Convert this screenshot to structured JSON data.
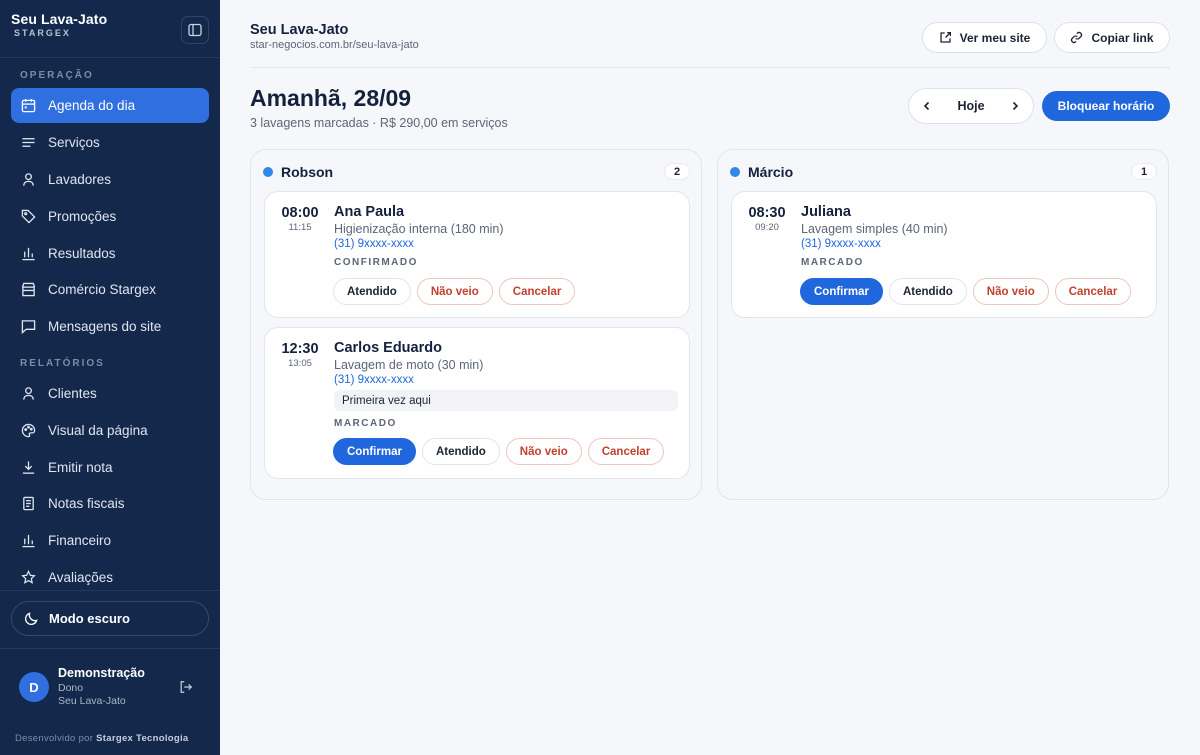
{
  "sidebar": {
    "brand": "Seu Lava-Jato",
    "brand_sub": "STARGEX",
    "section_operacao": "OPERAÇÃO",
    "section_relatorios": "RELATÓRIOS",
    "items": [
      {
        "label": "Agenda do dia",
        "icon": "calendar-icon"
      },
      {
        "label": "Serviços",
        "icon": "list-icon"
      },
      {
        "label": "Lavadores",
        "icon": "user-icon"
      },
      {
        "label": "Promoções",
        "icon": "tag-icon"
      },
      {
        "label": "Resultados",
        "icon": "bar-chart-icon"
      },
      {
        "label": "Comércio Stargex",
        "icon": "store-icon"
      },
      {
        "label": "Mensagens do site",
        "icon": "message-icon"
      },
      {
        "label": "Clientes",
        "icon": "user-icon"
      },
      {
        "label": "Visual da página",
        "icon": "palette-icon"
      },
      {
        "label": "Emitir nota",
        "icon": "download-icon"
      },
      {
        "label": "Notas fiscais",
        "icon": "receipt-icon"
      },
      {
        "label": "Financeiro",
        "icon": "bar-chart-icon"
      },
      {
        "label": "Avaliações",
        "icon": "star-icon"
      }
    ],
    "dark_mode_label": "Modo escuro",
    "user": {
      "initial": "D",
      "name": "Demonstração",
      "role": "Dono",
      "business": "Seu Lava-Jato"
    },
    "credit_prefix": "Desenvolvido por",
    "credit_company": "Stargex Tecnologia"
  },
  "header": {
    "site_title": "Seu Lava-Jato",
    "site_url": "star-negocios.com.br/seu-lava-jato",
    "view_site_label": "Ver meu site",
    "copy_link_label": "Copiar link"
  },
  "day": {
    "title": "Amanhã, 28/09",
    "subtitle": "3 lavagens marcadas · R$ 290,00 em serviços",
    "today_label": "Hoje",
    "block_label": "Bloquear horário"
  },
  "columns": [
    {
      "name": "Robson",
      "count": "2",
      "cards": [
        {
          "time": "08:00",
          "end": "11:15",
          "client": "Ana Paula",
          "service": "Higienização interna (180 min)",
          "phone": "(31) 9xxxx-xxxx",
          "note": "",
          "status": "CONFIRMADO",
          "actions": [
            "Atendido",
            "Não veio",
            "Cancelar"
          ]
        },
        {
          "time": "12:30",
          "end": "13:05",
          "client": "Carlos Eduardo",
          "service": "Lavagem de moto (30 min)",
          "phone": "(31) 9xxxx-xxxx",
          "note": "Primeira vez aqui",
          "status": "MARCADO",
          "actions": [
            "Confirmar",
            "Atendido",
            "Não veio",
            "Cancelar"
          ]
        }
      ]
    },
    {
      "name": "Márcio",
      "count": "1",
      "cards": [
        {
          "time": "08:30",
          "end": "09:20",
          "client": "Juliana",
          "service": "Lavagem simples (40 min)",
          "phone": "(31) 9xxxx-xxxx",
          "note": "",
          "status": "MARCADO",
          "actions": [
            "Confirmar",
            "Atendido",
            "Não veio",
            "Cancelar"
          ]
        }
      ]
    }
  ],
  "colors": {
    "sidebar_bg": "#13284a",
    "accent": "#2066dd",
    "danger": "#c2412d",
    "dot": "#2f8ae6"
  }
}
